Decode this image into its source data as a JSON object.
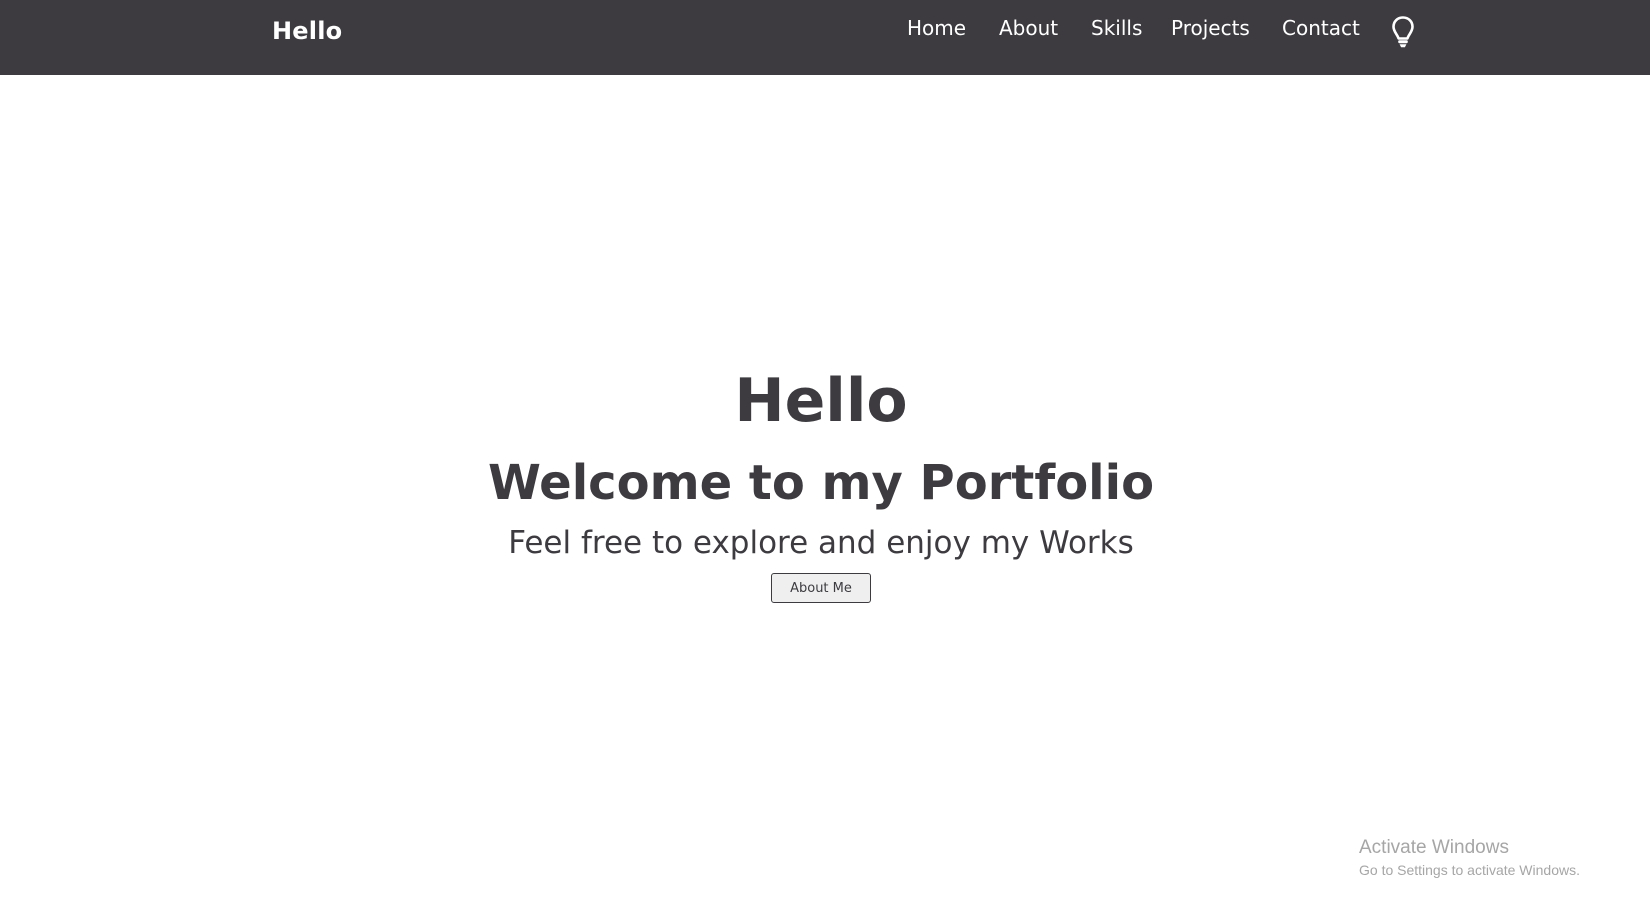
{
  "navbar": {
    "brand": "Hello",
    "links": [
      {
        "label": "Home"
      },
      {
        "label": "About"
      },
      {
        "label": "Skills"
      },
      {
        "label": "Projects"
      },
      {
        "label": "Contact"
      }
    ],
    "theme_icon": "lightbulb-icon"
  },
  "hero": {
    "title": "Hello",
    "subtitle": "Welcome to my Portfolio",
    "tagline": "Feel free to explore and enjoy my Works",
    "button_label": "About Me"
  },
  "watermark": {
    "title": "Activate Windows",
    "subtitle": "Go to Settings to activate Windows."
  },
  "colors": {
    "navbar_bg": "#3d3b40",
    "text_dark": "#3d3b40",
    "nav_text": "#ffffff",
    "watermark_text": "#a6a6a6"
  }
}
